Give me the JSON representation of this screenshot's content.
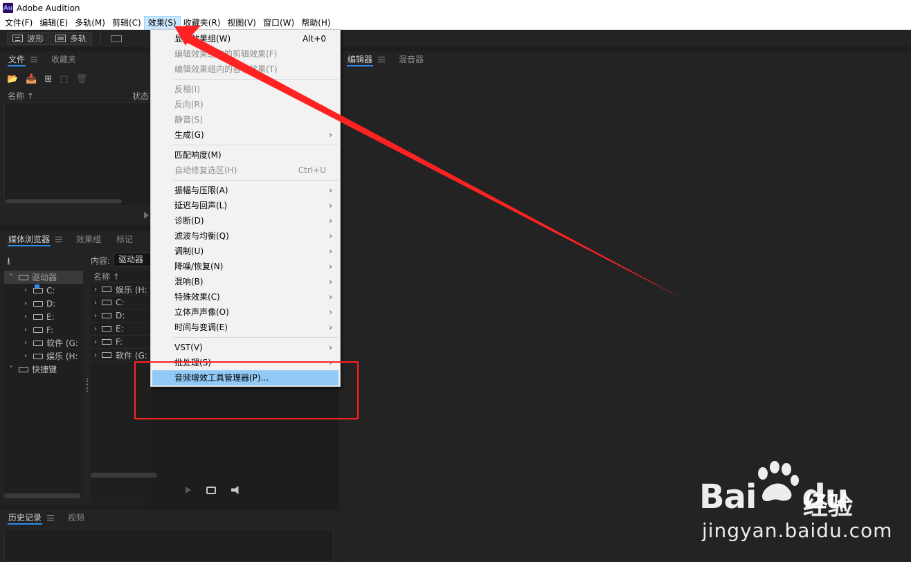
{
  "titlebar": {
    "logo": "Au",
    "title": "Adobe Audition"
  },
  "menubar": {
    "items": [
      {
        "label": "文件(F)"
      },
      {
        "label": "编辑(E)"
      },
      {
        "label": "多轨(M)"
      },
      {
        "label": "剪辑(C)"
      },
      {
        "label": "效果(S)"
      },
      {
        "label": "收藏夹(R)"
      },
      {
        "label": "视图(V)"
      },
      {
        "label": "窗口(W)"
      },
      {
        "label": "帮助(H)"
      }
    ],
    "active": "效果(S)"
  },
  "toolbar": {
    "waveform_label": "波形",
    "multitrack_label": "多轨"
  },
  "file_panel": {
    "tabs": [
      "文件",
      "收藏夹"
    ],
    "col_name": "名称",
    "col_status": "状态"
  },
  "media_panel": {
    "tabs": [
      "媒体浏览器",
      "效果组",
      "标记"
    ],
    "content_label": "内容:",
    "content_value": "驱动器",
    "tree": [
      {
        "label": "驱动器",
        "level": 0,
        "expanded": true,
        "selected": true
      },
      {
        "label": "C:",
        "level": 1
      },
      {
        "label": "D:",
        "level": 1
      },
      {
        "label": "E:",
        "level": 1
      },
      {
        "label": "F:",
        "level": 1
      },
      {
        "label": "软件 (G:",
        "level": 1
      },
      {
        "label": "娱乐 (H:",
        "level": 1
      },
      {
        "label": "快捷键",
        "level": 0,
        "expanded": true
      }
    ],
    "list_header": "名称",
    "list": [
      "娱乐 (H:",
      "C:",
      "D:",
      "E:",
      "F:",
      "软件 (G:"
    ]
  },
  "history_panel": {
    "tabs": [
      "历史记录",
      "视频"
    ]
  },
  "editor_panel": {
    "tabs": [
      "编辑器",
      "混音器"
    ]
  },
  "effects_menu": {
    "groups": [
      [
        {
          "label": "显示效果组(W)",
          "shortcut": "Alt+0",
          "disabled": false
        },
        {
          "label": "编辑效果组内的剪辑效果(F)",
          "disabled": true
        },
        {
          "label": "编辑效果组内的音轨效果(T)",
          "disabled": true
        }
      ],
      [
        {
          "label": "反相(I)",
          "disabled": true
        },
        {
          "label": "反向(R)",
          "disabled": true
        },
        {
          "label": "静音(S)",
          "disabled": true
        },
        {
          "label": "生成(G)",
          "submenu": true
        }
      ],
      [
        {
          "label": "匹配响度(M)"
        },
        {
          "label": "自动修复选区(H)",
          "shortcut": "Ctrl+U",
          "disabled": true
        }
      ],
      [
        {
          "label": "振幅与压限(A)",
          "submenu": true
        },
        {
          "label": "延迟与回声(L)",
          "submenu": true
        },
        {
          "label": "诊断(D)",
          "submenu": true
        },
        {
          "label": "滤波与均衡(Q)",
          "submenu": true
        },
        {
          "label": "调制(U)",
          "submenu": true
        },
        {
          "label": "降噪/恢复(N)",
          "submenu": true
        },
        {
          "label": "混响(B)",
          "submenu": true
        },
        {
          "label": "特殊效果(C)",
          "submenu": true
        },
        {
          "label": "立体声声像(O)",
          "submenu": true
        },
        {
          "label": "时间与变调(E)",
          "submenu": true
        }
      ],
      [
        {
          "label": "VST(V)",
          "submenu": true
        },
        {
          "label": "批处理(S)",
          "submenu": true
        },
        {
          "label": "音频增效工具管理器(P)...",
          "highlighted": true
        }
      ]
    ]
  },
  "watermark": {
    "brand": "Bai",
    "brand_suffix": "du",
    "brand_cn": "经验",
    "url": "jingyan.baidu.com"
  },
  "colors": {
    "annotation": "#ff2222",
    "menu_highlight": "#91c9f7",
    "tab_underline": "#2d8ceb"
  }
}
